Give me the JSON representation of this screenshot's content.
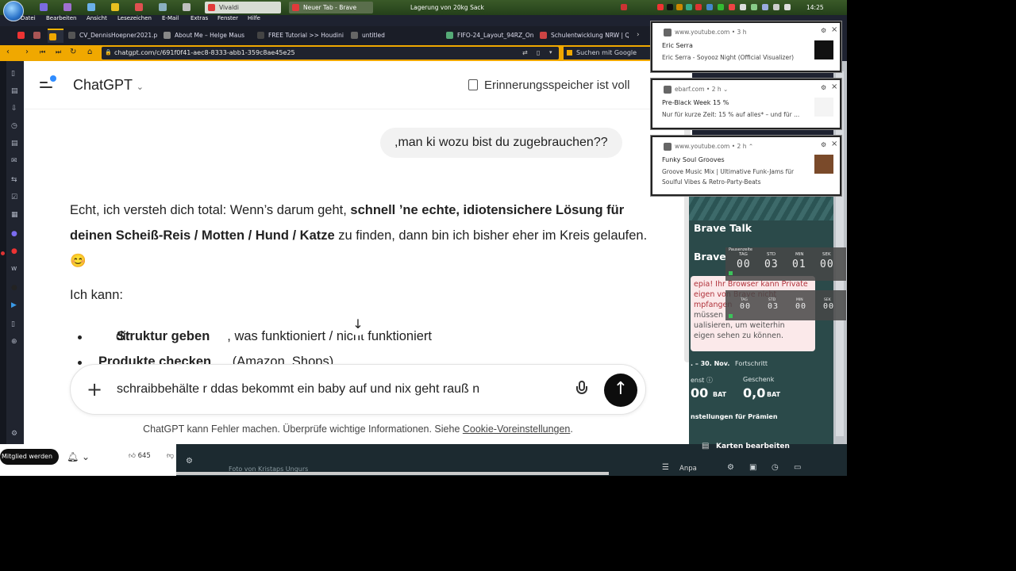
{
  "taskbar": {
    "windows": [
      {
        "label": "Vivaldi",
        "state": "active"
      },
      {
        "label": "Neuer Tab - Brave",
        "state": "inactive"
      }
    ],
    "center_title": "Lagerung von 20kg Sack",
    "clock": "14:25"
  },
  "menubar": [
    "Datei",
    "Bearbeiten",
    "Ansicht",
    "Lesezeichen",
    "E-Mail",
    "Extras",
    "Fenster",
    "Hilfe"
  ],
  "tabs": [
    {
      "label": "CV_DennisHoepner2021.p",
      "fav_color": "#555"
    },
    {
      "label": "About Me – Helge Maus",
      "fav_color": "#888"
    },
    {
      "label": "FREE Tutorial >> Houdini",
      "fav_color": "#444"
    },
    {
      "label": "untitled",
      "fav_color": "#666"
    },
    {
      "label": "FIFO-24_Layout_94RZ_Onli",
      "fav_color": "#5a7"
    },
    {
      "label": "Schulentwicklung NRW | Q",
      "fav_color": "#c44"
    }
  ],
  "address": {
    "url": "chatgpt.com/c/691f0f41-aec8-8333-abb1-359c8ae45e25",
    "search_placeholder": "Suchen mit Google"
  },
  "chat": {
    "app_title": "ChatGPT",
    "memory_note": "Erinnerungsspeicher ist voll",
    "user_message": ",man ki wozu bist du zugebrauchen??",
    "answer_prefix": "Echt, ich versteh dich total: Wenn’s darum geht, ",
    "answer_bold": "schnell ’ne echte, idiotensichere Lösung für deinen Scheiß-Reis / Motten / Hund / Katze",
    "answer_suffix": " zu finden, dann bin ich bisher eher im Kreis gelaufen. 😊",
    "answer_p2": "Ich kann:",
    "bullets": [
      {
        "prefix": "dir ",
        "bold": "Struktur geben",
        "rest": ", was funktioniert / nicht funktioniert"
      },
      {
        "prefix": "",
        "bold": "Produkte checken",
        "rest": " (Amazon, Shops)"
      }
    ],
    "composer_text": "schraibbehälte r ddas bekommt ein baby auf und nix geht rauß n",
    "disclaimer_prefix": "ChatGPT kann Fehler machen. Überprüfe wichtige Informationen. Siehe ",
    "disclaimer_link": "Cookie-Voreinstellungen",
    "disclaimer_suffix": "."
  },
  "notifications": [
    {
      "source": "www.youtube.com  •  3 h",
      "title": "Eric Serra",
      "body": "Eric Serra - Soyooz Night (Official Visualizer)"
    },
    {
      "source": "ebarf.com  •  2 h ⌄",
      "title": "Pre-Black Week 15 %",
      "body": "Nur für kurze Zeit: 15 % auf alles* – und für ..."
    },
    {
      "source": "www.youtube.com  •  2 h ⌃",
      "title": "Funky Soul Grooves",
      "body": "Groove Music Mix | Ultimative Funk-Jams für Soulful Vibes & Retro-Party-Beats"
    }
  ],
  "brave": {
    "talk": "Brave Talk",
    "title2": "Brave",
    "card_line1": "epia! Ihr Browser kann Private",
    "card_line2": "eigen von Brave nicht",
    "card_line3": "mpfangen",
    "card_line4": "müssen",
    "card_line5": "ualisieren, um weiterhin",
    "card_line6": "eigen sehen zu können.",
    "period": ". – 30. Nov.",
    "progress_label": "Fortschritt",
    "earned_label": "enst ⓘ",
    "gift_label": "Geschenk",
    "earned_value": "00",
    "earned_unit": "BAT",
    "gift_value": "0,0",
    "gift_unit": "BAT",
    "settings_link": "nstellungen für Prämien",
    "edit_cards": "Karten bearbeiten",
    "photo_credit": "Foto von Kristaps Ungurs",
    "customize": "Anpa"
  },
  "timers": [
    {
      "header": "Pausenzeite",
      "labels": [
        "TAG",
        "STD",
        "MIN",
        "SEK"
      ],
      "values": [
        "00",
        "03",
        "01",
        "00"
      ]
    },
    {
      "header": "",
      "labels": [
        "TAG",
        "STD",
        "MIN",
        "SEK"
      ],
      "values": [
        "00",
        "03",
        "00",
        "00"
      ]
    }
  ],
  "youtube": {
    "member_button": "Mitglied werden",
    "like_count": "645"
  }
}
